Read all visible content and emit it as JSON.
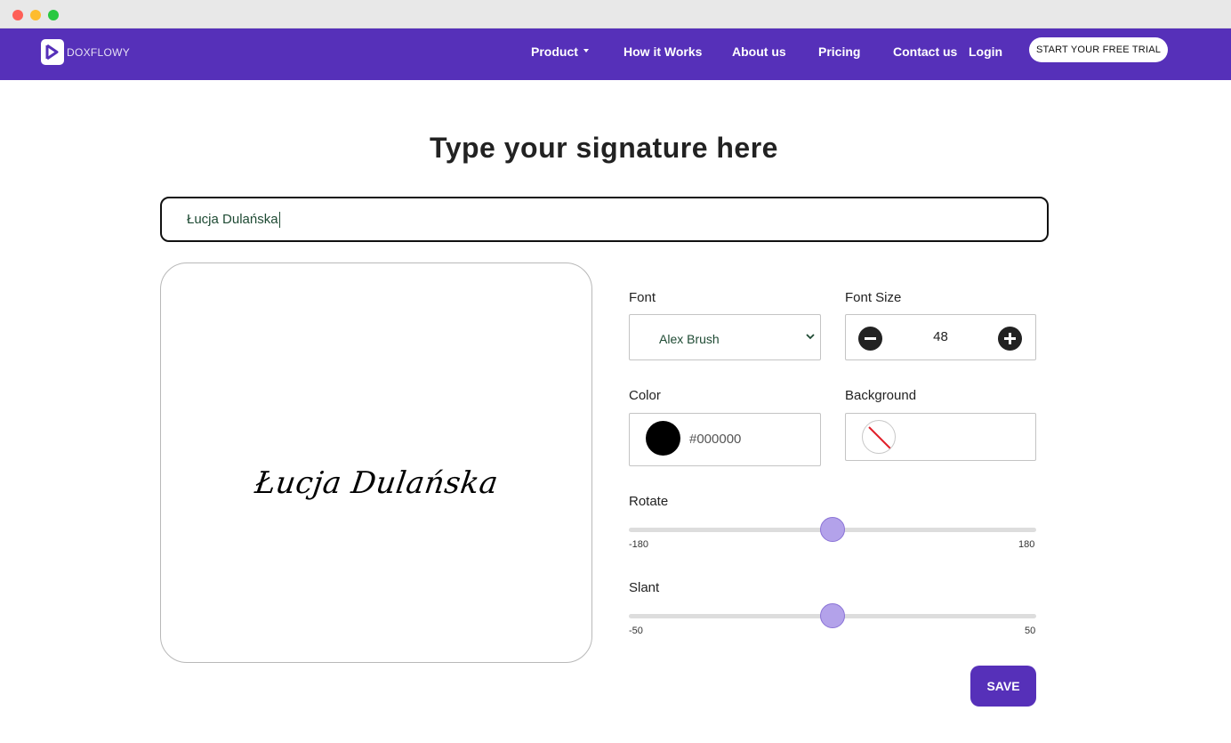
{
  "navbar": {
    "brand": "DOXFLOWY",
    "links": [
      "Product",
      "How it Works",
      "About us",
      "Pricing",
      "Contact us",
      "Login"
    ],
    "cta": "START YOUR FREE TRIAL"
  },
  "main": {
    "heading": "Type your signature here",
    "signature_input": "Łucja Dulańska",
    "preview_text": "Łucja Dulańska"
  },
  "controls": {
    "font_label": "Font",
    "font_value": "Alex Brush",
    "font_size_label": "Font Size",
    "font_size_value": "48",
    "color_label": "Color",
    "color_value": "#000000",
    "background_label": "Background",
    "rotate_label": "Rotate",
    "rotate_min": "-180",
    "rotate_max": "180",
    "rotate_value": 0,
    "slant_label": "Slant",
    "slant_min": "-50",
    "slant_max": "50",
    "slant_value": 0,
    "save_label": "SAVE"
  },
  "colors": {
    "brand": "#5630b9",
    "slider_thumb": "#b3a2ea",
    "signature_color": "#000000"
  }
}
